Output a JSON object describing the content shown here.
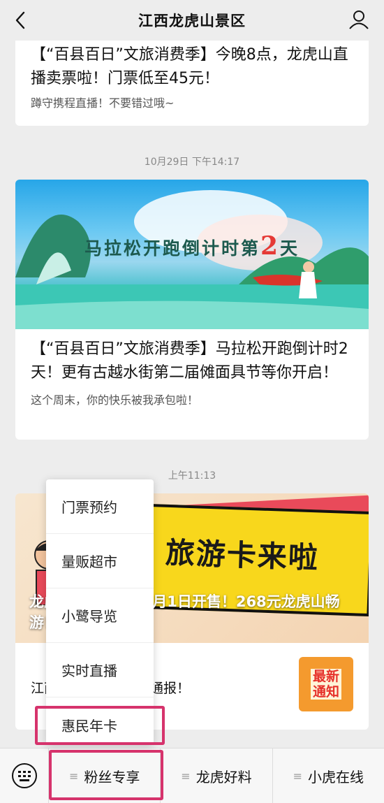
{
  "header": {
    "title": "江西龙虎山景区"
  },
  "icons": {
    "back": "back-chevron-icon",
    "profile": "user-profile-icon",
    "keyboard": "keyboard-icon",
    "menu": "hamburger-icon"
  },
  "articles": [
    {
      "title": "【“百县百日”文旅消费季】今晚8点，龙虎山直播卖票啦！门票低至45元！",
      "subtitle": "蹲守携程直播！不要错过哦~"
    },
    {
      "timestamp": "10月29日 下午14:17",
      "banner_text": "马拉松开跑倒计时第",
      "banner_number": "2",
      "banner_suffix": "天",
      "title": "【“百县百日”文旅消费季】马拉松开跑倒计时2天！更有古越水街第二届傩面具节等你开启！",
      "subtitle": "这个周末，你的快乐被我承包啦！"
    },
    {
      "timestamp": "上午11:13",
      "banner_big_text": "旅游卡来啦",
      "banner_title": "龙虎山旅游年卡11月1日开售！268元龙虎山畅游！",
      "sub_item": "江西龙虎山景区情况通报！",
      "badge_line1": "最新",
      "badge_line2": "通知"
    }
  ],
  "popup_menu": {
    "items": [
      "门票预约",
      "量贩超市",
      "小鹭导览",
      "实时直播",
      "惠民年卡"
    ]
  },
  "bottom_menu": {
    "tabs": [
      "粉丝专享",
      "龙虎好料",
      "小虎在线"
    ]
  },
  "colors": {
    "highlight": "#d6336c",
    "background": "#ededed"
  }
}
